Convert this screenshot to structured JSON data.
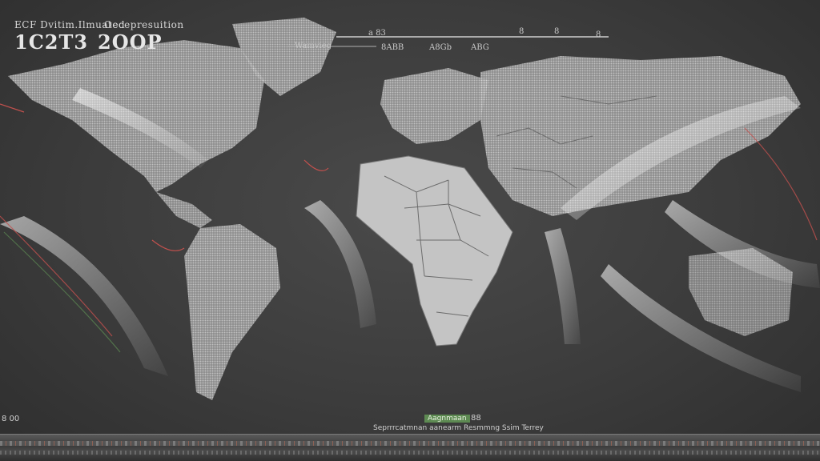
{
  "header": {
    "subtitle_left": "ECF Dvitim.Ilmuated",
    "subtitle_right": "Oecepresuition",
    "year_left": "1C2T3",
    "year_right": "2OOP"
  },
  "timeline": {
    "top_labels": [
      "a 83",
      "8",
      "8",
      "8"
    ],
    "sub_labels": [
      "Wamvieg",
      "8ABB",
      "A8Gb",
      "ABG"
    ]
  },
  "footer": {
    "left_value": "8 00",
    "legend_label": "Aagnmaan",
    "legend_value": "88",
    "caption": "Seprrrcatmnan aanearm Resmmng Ssim Terrey"
  },
  "colors": {
    "land": "#c4c4c4",
    "ocean": "#3c3c3c",
    "flow": "#e0e0e0",
    "accent_red": "#c0504d",
    "accent_green": "#5d8a52"
  }
}
